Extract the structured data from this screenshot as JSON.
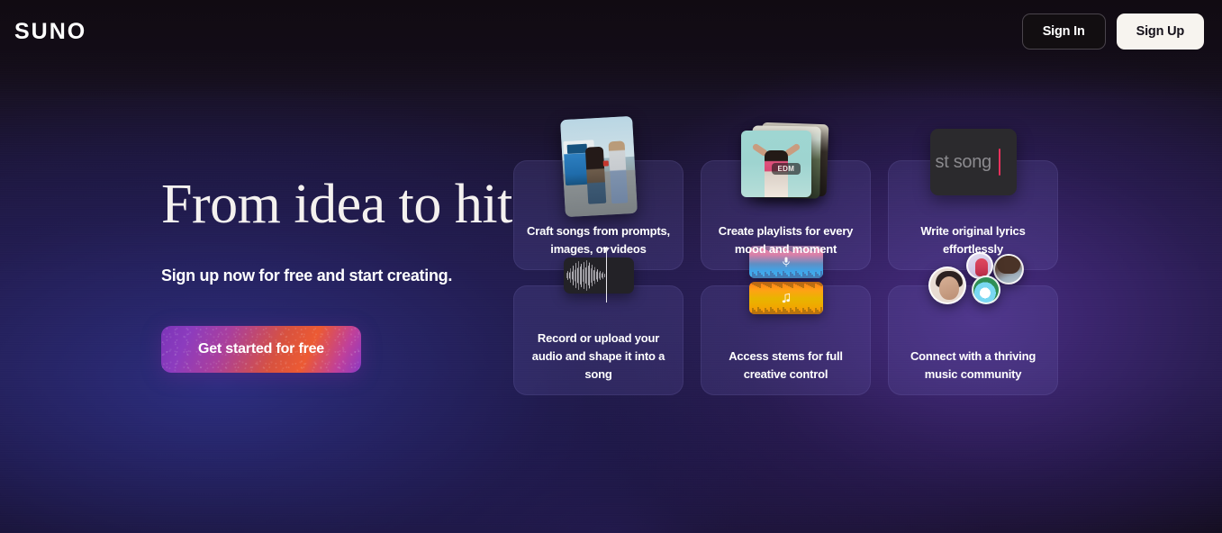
{
  "header": {
    "logo": "SUNO",
    "sign_in_label": "Sign In",
    "sign_up_label": "Sign Up"
  },
  "hero": {
    "title": "From idea to hit",
    "subtitle": "Sign up now for free and start creating.",
    "cta_label": "Get started for free"
  },
  "features": [
    {
      "label": "Craft songs from prompts, images, or videos",
      "art": "photo-thumbnail",
      "icon_name": "photo-icon"
    },
    {
      "label": "Create playlists for every mood and moment",
      "art": "stacked-playlist-cards",
      "badge": "EDM",
      "icon_name": "playlist-stack-icon"
    },
    {
      "label": "Write original lyrics effortlessly",
      "art": "lyrics-text-box",
      "editor_text": "st song",
      "icon_name": "text-cursor-icon"
    },
    {
      "label": "Record or upload your audio and shape it into a song",
      "art": "audio-waveform",
      "icon_name": "waveform-icon"
    },
    {
      "label": "Access stems for full creative control",
      "art": "stem-tracks",
      "stems": [
        "vocal-stem",
        "instrument-stem"
      ],
      "icon_name": "stems-icon"
    },
    {
      "label": "Connect with a thriving music community",
      "art": "avatar-cluster",
      "icon_name": "community-icon"
    }
  ],
  "colors": {
    "accent_start": "#7b34b8",
    "accent_end": "#ec5a33",
    "caret": "#e8315c",
    "card_bg": "rgba(108,100,184,0.20)",
    "signup_bg": "#f7f4ef",
    "page_bg": "#1b1434"
  }
}
